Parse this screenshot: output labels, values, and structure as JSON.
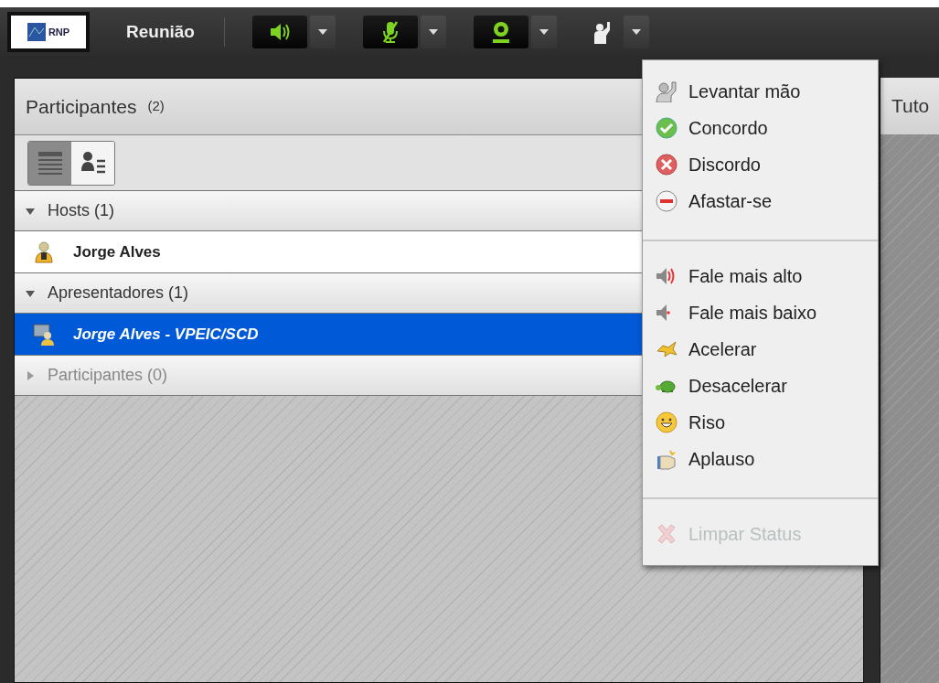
{
  "app_bar": {
    "logo": "RNP",
    "title": "Reunião",
    "controls": [
      {
        "kind": "speaker"
      },
      {
        "kind": "mic-off"
      },
      {
        "kind": "camera"
      },
      {
        "kind": "status"
      }
    ]
  },
  "participants_panel": {
    "title": "Participantes",
    "count": "(2)",
    "views": [
      {
        "kind": "list",
        "selected": true
      },
      {
        "kind": "cards",
        "selected": false
      }
    ],
    "groups": [
      {
        "label": "Hosts (1)",
        "expanded": true,
        "disabled": false,
        "members": [
          {
            "name": "Jorge Alves",
            "kind": "host",
            "selected": false
          }
        ]
      },
      {
        "label": "Apresentadores (1)",
        "expanded": true,
        "disabled": false,
        "members": [
          {
            "name": "Jorge Alves - VPEIC/SCD",
            "kind": "presenter",
            "selected": true
          }
        ]
      },
      {
        "label": "Participantes (0)",
        "expanded": false,
        "disabled": true
      }
    ]
  },
  "side_panel": {
    "title": "Tuto"
  },
  "status_menu": {
    "sections": [
      {
        "items": [
          {
            "label": "Levantar mão",
            "kind": "hand",
            "disabled": false
          },
          {
            "label": "Concordo",
            "kind": "agree",
            "disabled": false
          },
          {
            "label": "Discordo",
            "kind": "disagree",
            "disabled": false
          },
          {
            "label": "Afastar-se",
            "kind": "away",
            "disabled": false
          }
        ]
      },
      {
        "items": [
          {
            "label": "Fale mais alto",
            "kind": "louder",
            "disabled": false
          },
          {
            "label": "Fale mais baixo",
            "kind": "softer",
            "disabled": false
          },
          {
            "label": "Acelerar",
            "kind": "faster",
            "disabled": false
          },
          {
            "label": "Desacelerar",
            "kind": "slower",
            "disabled": false
          },
          {
            "label": "Riso",
            "kind": "laugh",
            "disabled": false
          },
          {
            "label": "Aplauso",
            "kind": "applause",
            "disabled": false
          }
        ]
      },
      {
        "items": [
          {
            "label": "Limpar Status",
            "kind": "clear",
            "disabled": true
          }
        ]
      }
    ]
  }
}
